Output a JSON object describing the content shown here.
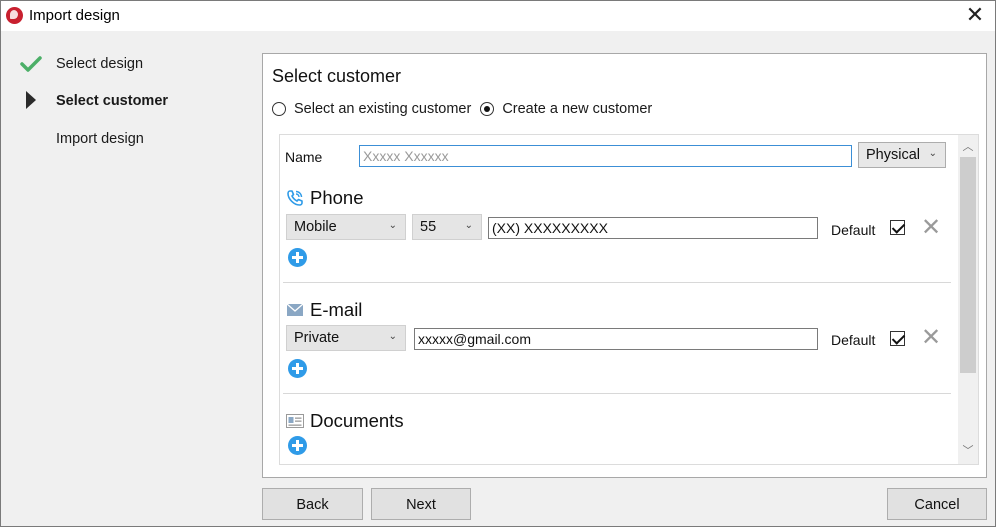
{
  "window": {
    "title": "Import design",
    "close_glyph": "✕"
  },
  "steps": [
    {
      "label": "Select design",
      "state": "done",
      "icon": "checkmark-icon"
    },
    {
      "label": "Select customer",
      "state": "current",
      "icon": "arrow-right-icon"
    },
    {
      "label": "Import design",
      "state": "pending",
      "icon": ""
    }
  ],
  "panel": {
    "title": "Select customer",
    "radios": [
      {
        "label": "Select an existing customer",
        "checked": false
      },
      {
        "label": "Create a new customer",
        "checked": true
      }
    ]
  },
  "form": {
    "name_label": "Name",
    "name_placeholder": "Xxxxx Xxxxxx",
    "person_type": "Physical",
    "phone": {
      "title": "Phone",
      "icon": "phone-icon",
      "type": "Mobile",
      "country_code": "55",
      "number": "(XX) XXXXXXXXX",
      "default_label": "Default",
      "default_checked": true
    },
    "email": {
      "title": "E-mail",
      "icon": "envelope-icon",
      "type": "Private",
      "address": "xxxxx@gmail.com",
      "default_label": "Default",
      "default_checked": true
    },
    "documents": {
      "title": "Documents",
      "icon": "id-card-icon"
    },
    "delete_glyph": "✕",
    "chevron_glyph": "⌄"
  },
  "buttons": {
    "back": "Back",
    "next": "Next",
    "cancel": "Cancel"
  },
  "colors": {
    "accent": "#2f9be8",
    "check_green": "#4caf68",
    "app_red": "#c8202f",
    "focus_border": "#3c8fd6"
  }
}
